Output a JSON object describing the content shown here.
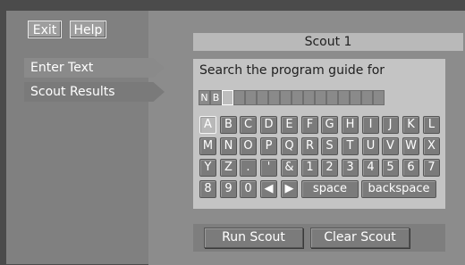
{
  "header_buttons": {
    "exit": "Exit",
    "help": "Help"
  },
  "menu": [
    "Enter Text",
    "Scout Results"
  ],
  "title": "Scout 1",
  "prompt": "Search the program guide for",
  "entered_text": [
    "N",
    "B"
  ],
  "keyboard_rows": [
    [
      "A",
      "B",
      "C",
      "D",
      "E",
      "F",
      "G",
      "H",
      "I",
      "J",
      "K",
      "L"
    ],
    [
      "M",
      "N",
      "O",
      "P",
      "Q",
      "R",
      "S",
      "T",
      "U",
      "V",
      "W",
      "X"
    ],
    [
      "Y",
      "Z",
      ".",
      "'",
      "&",
      "1",
      "2",
      "3",
      "4",
      "5",
      "6",
      "7"
    ]
  ],
  "keyboard_row4": [
    "8",
    "9",
    "0",
    "◀",
    "▶",
    "space",
    "backspace"
  ],
  "selected_key": "A",
  "actions": {
    "run": "Run Scout",
    "clear": "Clear Scout"
  }
}
